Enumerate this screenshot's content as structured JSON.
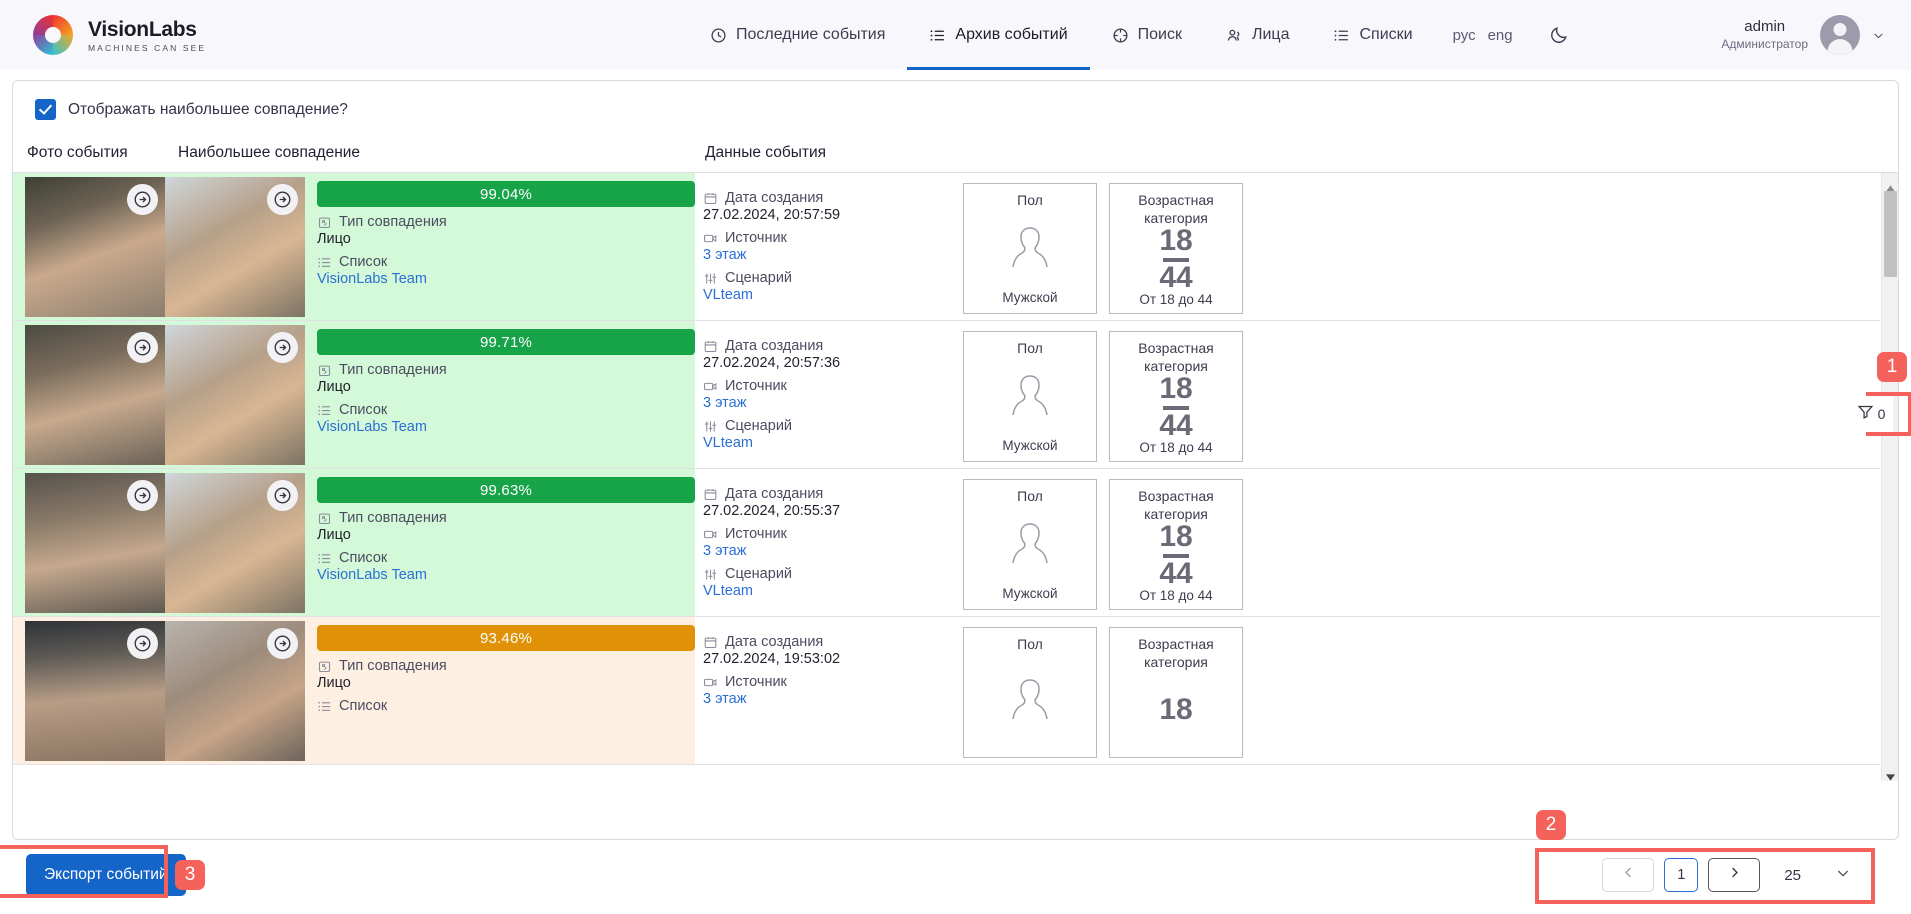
{
  "brand": {
    "name": "VisionLabs",
    "tagline": "MACHINES CAN SEE",
    "logo_icon": "visionlabs-ring-logo"
  },
  "nav": {
    "items": [
      {
        "label": "Последние события",
        "icon": "clock-icon",
        "active": false
      },
      {
        "label": "Архив событий",
        "icon": "list-archive-icon",
        "active": true
      },
      {
        "label": "Поиск",
        "icon": "target-search-icon",
        "active": false
      },
      {
        "label": "Лица",
        "icon": "people-icon",
        "active": false
      },
      {
        "label": "Списки",
        "icon": "list-icon",
        "active": false
      }
    ],
    "languages": [
      {
        "code": "рус"
      },
      {
        "code": "eng"
      }
    ],
    "theme_toggle_icon": "moon-icon",
    "active_accent": "#1565c9"
  },
  "user": {
    "name": "admin",
    "role": "Администратор",
    "avatar_icon": "avatar-icon",
    "caret_icon": "chevron-down-icon"
  },
  "filters": {
    "show_best_match": {
      "label": "Отображать наибольшее совпадение?",
      "checked": true
    }
  },
  "columns": {
    "photo": "Фото события",
    "match": "Наибольшее совпадение",
    "data": "Данные события"
  },
  "labels": {
    "match_type": "Тип совпадения",
    "list": "Список",
    "created_at": "Дата создания",
    "source": "Источник",
    "scenario": "Сценарий",
    "gender_title": "Пол",
    "age_title": "Возрастная категория"
  },
  "icons": {
    "match_type": "match-type-icon",
    "list": "list-icon",
    "calendar": "calendar-icon",
    "camera": "camera-icon",
    "scenario": "sliders-icon",
    "arrow_right": "arrow-right-circle-icon",
    "filter": "filter-icon",
    "person_silhouette": "person-silhouette-icon"
  },
  "rows": [
    {
      "tone": "green",
      "score": "99.04%",
      "match_type": "Лицо",
      "list": "VisionLabs Team",
      "created_at": "27.02.2024, 20:57:59",
      "source": "3 этаж",
      "scenario": "VLteam",
      "gender": "Мужской",
      "age_from": "18",
      "age_to": "44",
      "age_range": "От 18 до 44"
    },
    {
      "tone": "green",
      "score": "99.71%",
      "match_type": "Лицо",
      "list": "VisionLabs Team",
      "created_at": "27.02.2024, 20:57:36",
      "source": "3 этаж",
      "scenario": "VLteam",
      "gender": "Мужской",
      "age_from": "18",
      "age_to": "44",
      "age_range": "От 18 до 44"
    },
    {
      "tone": "green",
      "score": "99.63%",
      "match_type": "Лицо",
      "list": "VisionLabs Team",
      "created_at": "27.02.2024, 20:55:37",
      "source": "3 этаж",
      "scenario": "VLteam",
      "gender": "Мужской",
      "age_from": "18",
      "age_to": "44",
      "age_range": "От 18 до 44"
    },
    {
      "tone": "amber",
      "score": "93.46%",
      "match_type": "Лицо",
      "list": "Список",
      "created_at": "27.02.2024, 19:53:02",
      "source": "3 этаж",
      "scenario": "",
      "gender": "",
      "age_from": "18",
      "age_to": "",
      "age_range": ""
    }
  ],
  "side_filter": {
    "count": "0",
    "icon": "filter-icon"
  },
  "footer": {
    "export_label": "Экспорт событий",
    "pagination": {
      "prev_icon": "chevron-left-icon",
      "next_icon": "chevron-right-icon",
      "current_page": "1",
      "page_size": "25",
      "page_size_caret": "chevron-down-icon"
    }
  },
  "callouts": [
    {
      "number": "1"
    },
    {
      "number": "2"
    },
    {
      "number": "3"
    }
  ],
  "colors": {
    "accent_blue": "#1565c9",
    "match_green": "#17a348",
    "match_green_bg": "#d3f9d8",
    "match_amber": "#e09106",
    "match_amber_bg": "#fdf0e3",
    "callout_red": "#f5625c",
    "link_blue": "#2b6fd4"
  }
}
